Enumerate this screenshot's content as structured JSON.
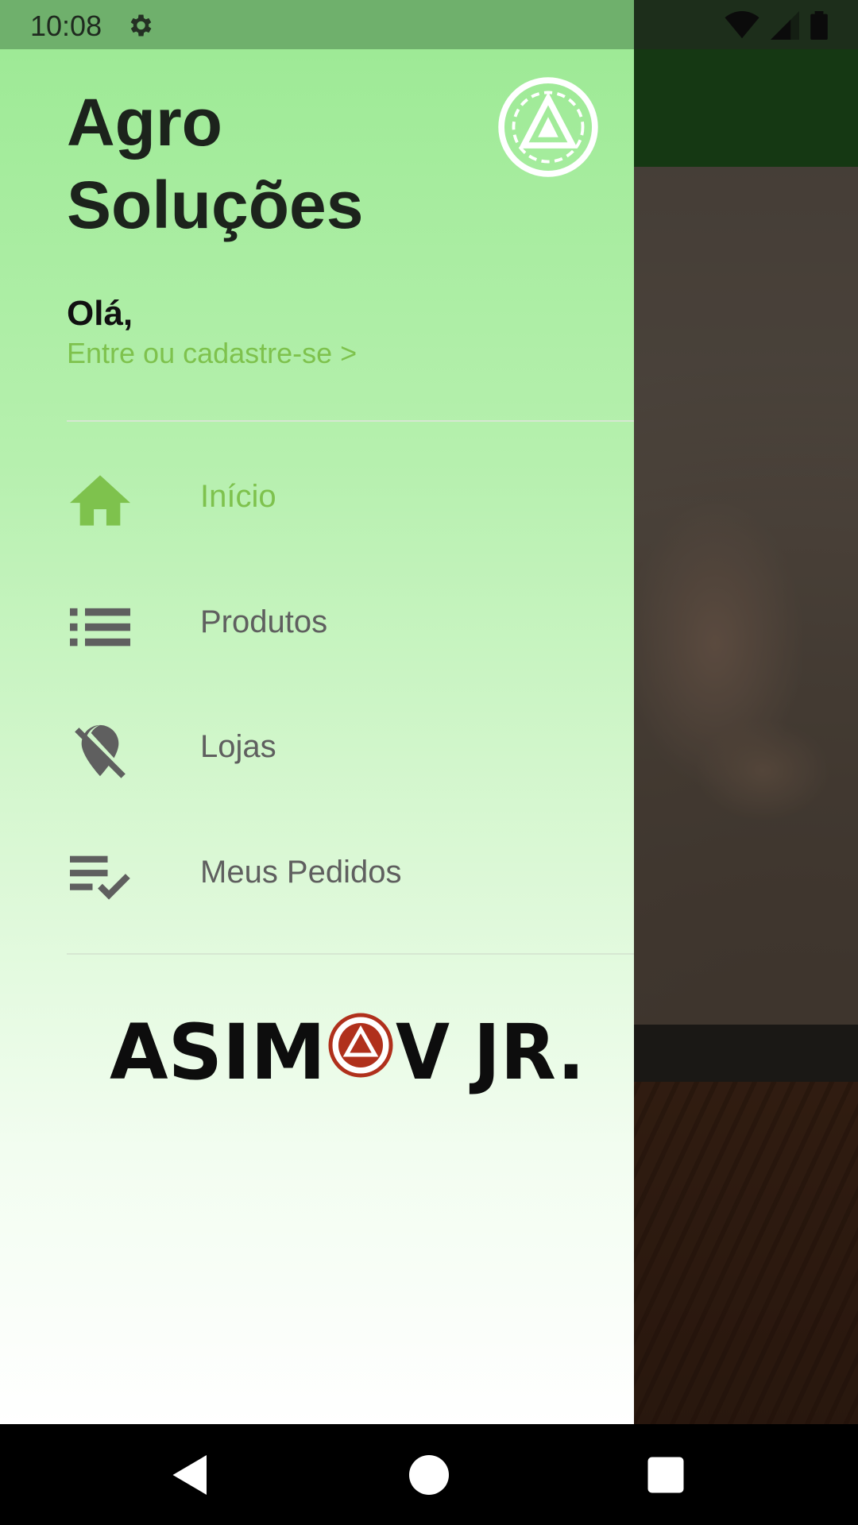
{
  "status_bar": {
    "time": "10:08"
  },
  "drawer": {
    "title": "Agro Soluções",
    "greeting": "Olá,",
    "login_link": "Entre ou cadastre-se >",
    "menu_items": [
      {
        "label": "Início",
        "icon": "home-icon",
        "active": true
      },
      {
        "label": "Produtos",
        "icon": "list-icon",
        "active": false
      },
      {
        "label": "Lojas",
        "icon": "location-off-icon",
        "active": false
      },
      {
        "label": "Meus Pedidos",
        "icon": "playlist-check-icon",
        "active": false
      }
    ],
    "brand": "ASIMOV JR."
  },
  "colors": {
    "accent": "#7ec24d",
    "toolbar": "#2f7d2a",
    "drawer_top": "#9eea96",
    "icon": "#5f5f5f"
  }
}
